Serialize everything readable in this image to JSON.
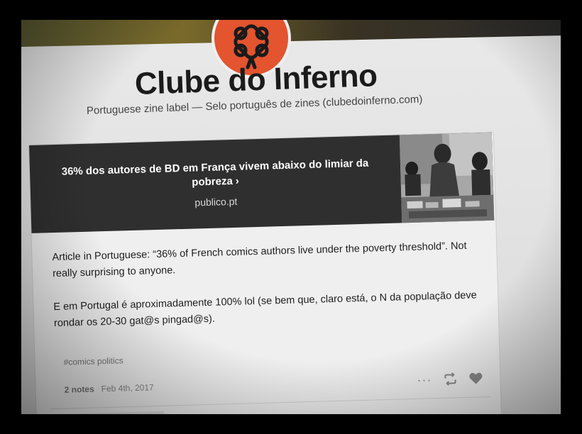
{
  "blog": {
    "title": "Clube do Inferno",
    "description": "Portuguese zine label — Selo português de zines (clubedoinferno.com)",
    "avatar_color": "#e3542f"
  },
  "post": {
    "link": {
      "title": "36% dos autores de BD em França vivem abaixo do limiar da pobreza",
      "chevron": "›",
      "source": "publico.pt"
    },
    "paragraphs": [
      "Article in Portuguese: “36% of French comics authors live under the poverty threshold”. Not really surprising to anyone.",
      "E em Portugal é aproximadamente 100% lol (se bem que, claro está, o N da população deve rondar os 20-30 gat@s pingad@s)."
    ],
    "tag": "#comics politics",
    "notes": "2 notes",
    "date": "Feb 4th, 2017",
    "icons": {
      "more": "more-icon",
      "reblog": "reblog-icon",
      "like": "heart-icon"
    }
  },
  "colors": {
    "link_card_bg": "#2f2f2f",
    "page_bg": "#e6e6e6"
  }
}
